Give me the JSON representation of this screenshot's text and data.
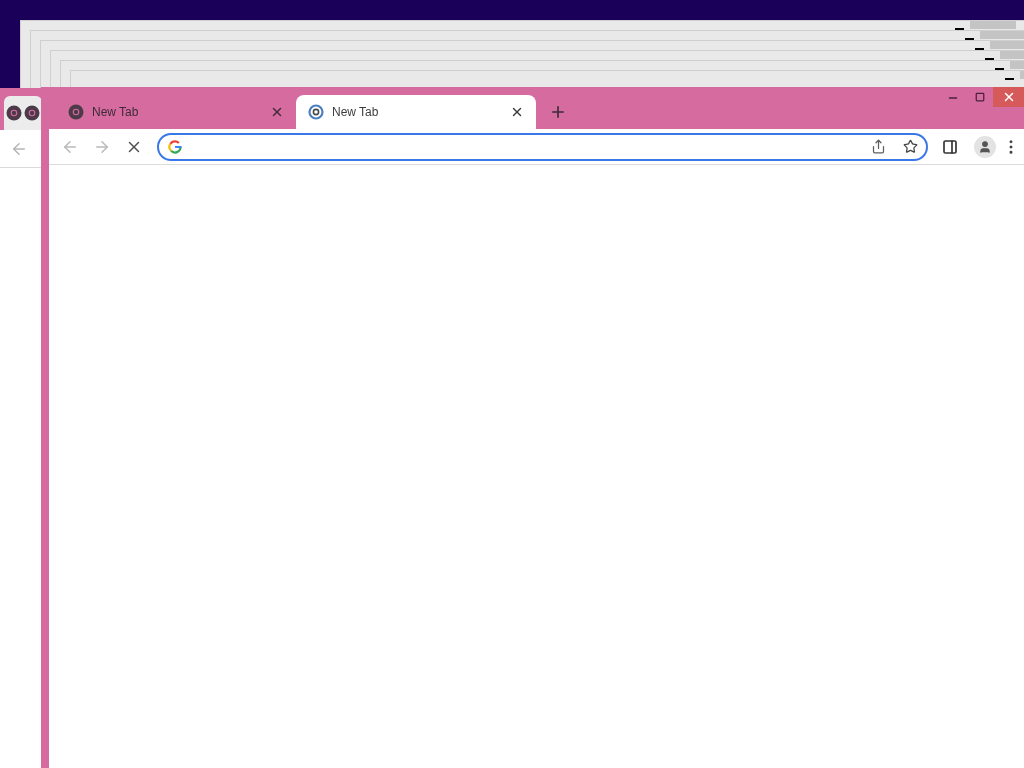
{
  "main_window": {
    "tabs": [
      {
        "title": "New Tab",
        "selected": false
      },
      {
        "title": "New Tab",
        "selected": true
      }
    ],
    "loading": true
  }
}
